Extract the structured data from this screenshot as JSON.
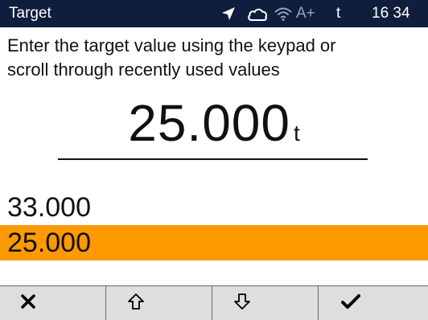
{
  "statusbar": {
    "title": "Target",
    "icons": [
      "location-arrow-icon",
      "cloud-icon",
      "wifi-icon"
    ],
    "accuracy": "A+",
    "unit": "t",
    "time": "16 34"
  },
  "instruction": {
    "line1": "Enter the target value using the keypad or",
    "line2": "scroll through recently used values"
  },
  "target": {
    "value": "25.000",
    "unit": "t"
  },
  "recent_values": [
    {
      "value": "33.000",
      "selected": false
    },
    {
      "value": "25.000",
      "selected": true
    }
  ],
  "softkeys": [
    {
      "name": "cancel",
      "icon": "close-icon"
    },
    {
      "name": "scroll-up",
      "icon": "arrow-up-icon"
    },
    {
      "name": "scroll-down",
      "icon": "arrow-down-icon"
    },
    {
      "name": "confirm",
      "icon": "checkmark-icon"
    }
  ],
  "colors": {
    "statusbar_bg": "#0f1e3c",
    "highlight": "#ff9900",
    "softkey_bg": "#dedede"
  }
}
